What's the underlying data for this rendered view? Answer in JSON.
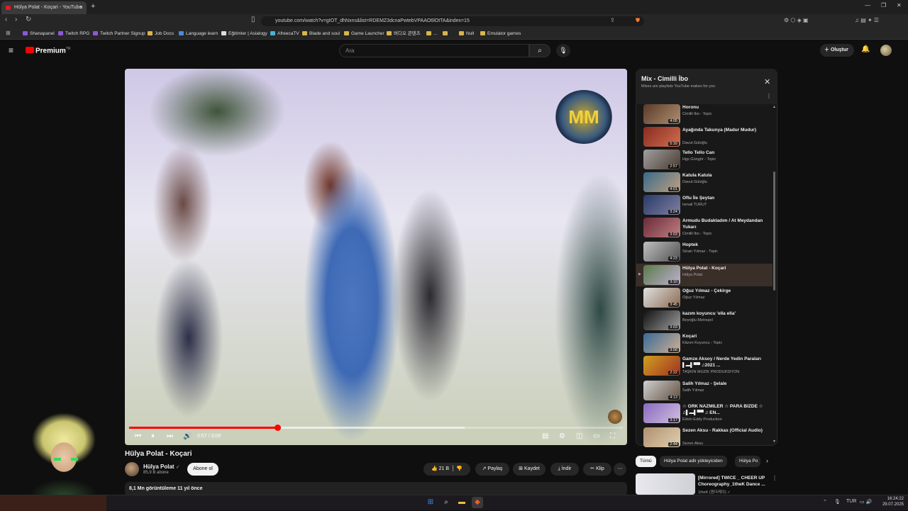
{
  "browser": {
    "tab_title": "Hülya Polat - Koçari - YouTube",
    "tab_close": "×",
    "new_tab": "+",
    "url": "youtube.com/watch?v=gIOT_dhNxns&list=RDEMZ3dcnaPwtebVPAAO6lOtTA&index=15",
    "bookmarks": [
      "Shanapanel",
      "Twitch RPG",
      "Twitch Partner Signup",
      "Job Docs",
      "Language learn",
      "Eğitimler | Asialogy",
      "AfreecaTV",
      "Blade and soul",
      "Game Launcher",
      "버디오 콘텐츠",
      "...",
      "",
      "Null",
      "Emulator games"
    ]
  },
  "youtube": {
    "logo_text": "Premium",
    "logo_sup": "TR",
    "search_placeholder": "Ara",
    "create_label": "Oluştur"
  },
  "player": {
    "overlay_logo": "MM",
    "time": "0:57 / 3:09",
    "progress_fraction": 0.3
  },
  "video": {
    "title": "Hülya Polat - Koçari",
    "channel": "Hülya Polat",
    "subscribers": "85,9 B abone",
    "subscribe_label": "Abone ol",
    "likes": "21 B",
    "share_label": "Paylaş",
    "save_label": "Kaydet",
    "download_label": "İndir",
    "clip_label": "Klip",
    "views_line": "8,1 Mn görüntüleme  11 yıl önce"
  },
  "playlist": {
    "title": "Mix - Cimilli İbo",
    "subtitle": "Mixes are playlists YouTube makes for you",
    "items": [
      {
        "title": "Horonu",
        "channel": "Cimilli İbo - Topic",
        "duration": "4:05",
        "colors": [
          "#5a3a2a",
          "#b09070"
        ]
      },
      {
        "title": "Ayağında Takunya (Madur Mudur)",
        "channel": "Davut Güloğlu",
        "duration": "5:16",
        "colors": [
          "#8a2a20",
          "#d07050"
        ]
      },
      {
        "title": "Tello Tello Can",
        "channel": "Hgs Güngör - Topic",
        "duration": "2:57",
        "colors": [
          "#a0a0a0",
          "#4a3a30"
        ]
      },
      {
        "title": "Katula Katula",
        "channel": "Davut Güloğlu",
        "duration": "4:01",
        "colors": [
          "#3a6a8a",
          "#c0a080"
        ]
      },
      {
        "title": "Oflu İle Şeytan",
        "channel": "İsmail TÜRÜT",
        "duration": "3:24",
        "colors": [
          "#2a3a6a",
          "#8080a0"
        ]
      },
      {
        "title": "Armudu Budakladım / At Meydandan Yukarı",
        "channel": "Cimilli İbo - Topic",
        "duration": "3:03",
        "colors": [
          "#6a2a3a",
          "#c08080"
        ]
      },
      {
        "title": "Hoptek",
        "channel": "Sinan Yılmaz - Topic",
        "duration": "4:23",
        "colors": [
          "#c0c0c0",
          "#505050"
        ]
      },
      {
        "title": "Hülya Polat - Koçari",
        "channel": "Hülya Polat",
        "duration": "3:10",
        "colors": [
          "#5a7a4a",
          "#c0b0d0"
        ]
      },
      {
        "title": "Oğuz Yılmaz - Çekirge",
        "channel": "Oğuz Yılmaz",
        "duration": "3:45",
        "colors": [
          "#e0e0e0",
          "#8a6a50"
        ]
      },
      {
        "title": "kazım koyuncu 'ella ella'",
        "channel": "Beyoğlu Metropol",
        "duration": "3:03",
        "colors": [
          "#101010",
          "#a0a0a0"
        ]
      },
      {
        "title": "Koçari",
        "channel": "Kâzım Koyuncu - Topic",
        "duration": "3:58",
        "colors": [
          "#3a6a9a",
          "#d0b090"
        ]
      },
      {
        "title": "Gamze Aksoy / Nerde Yedin Paraları ▌▬▌▀▀ ♫2021 ...",
        "channel": "TAŞKIN MÜZİK PRODÜKSİYON",
        "duration": "2:22",
        "colors": [
          "#d0a020",
          "#a03020"
        ]
      },
      {
        "title": "Salih Yılmaz - Şelale",
        "channel": "Salih Yılmaz",
        "duration": "4:13",
        "colors": [
          "#d0d0d0",
          "#605040"
        ]
      },
      {
        "title": "☆ ORK NAZMILER ☆ PARA BIZDE ☆ ♫▌▬▌▀▀ ♫ EN...",
        "channel": "Edvin Eddy Production",
        "duration": "3:17",
        "colors": [
          "#8a6ac0",
          "#d0c0e0"
        ]
      },
      {
        "title": "Sezen Aksu - Rakkas (Official Audio)",
        "channel": "Sezen Aksu",
        "duration": "2:44",
        "colors": [
          "#b09070",
          "#e0d0b0"
        ]
      }
    ],
    "active_index": 7
  },
  "chips": [
    "Tümü",
    "Hülya Polat adlı yükleyiciden",
    "Hülya Po"
  ],
  "recommendation": {
    "title": "[Mirrored] TWICE _ CHEER UP Choreography_1theK Dance ...",
    "channel": "1theK (원더케이) ✓"
  },
  "taskbar": {
    "lang": "TUR",
    "time": "16:24:22",
    "date": "29.07.2025"
  }
}
